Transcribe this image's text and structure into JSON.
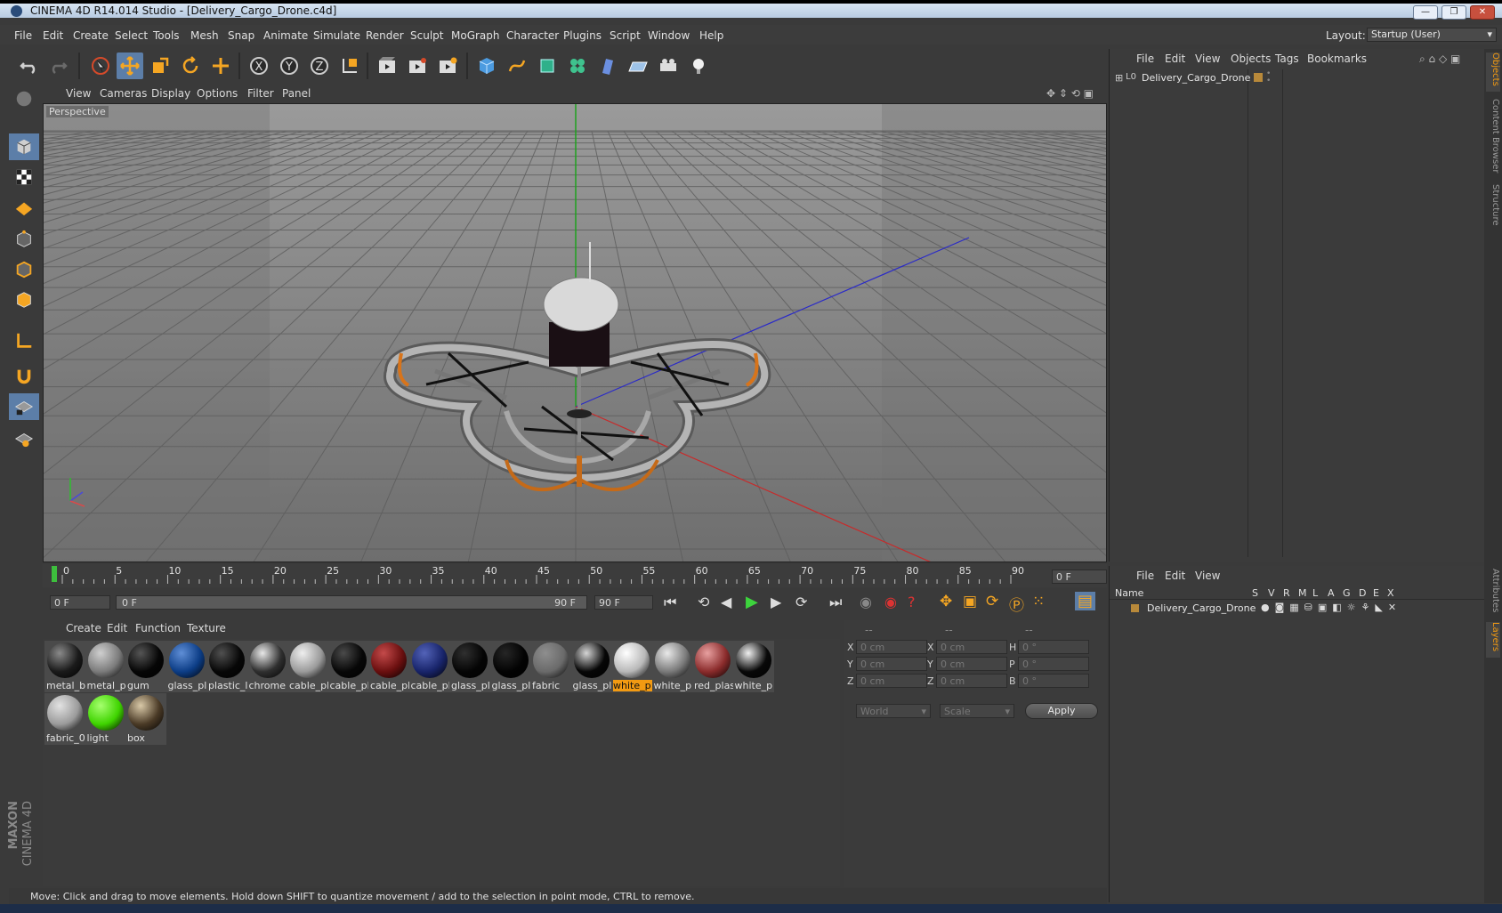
{
  "window": {
    "title": "CINEMA 4D R14.014 Studio - [Delivery_Cargo_Drone.c4d]",
    "controls": [
      "—",
      "❐",
      "✕"
    ]
  },
  "menubar": {
    "items": [
      "File",
      "Edit",
      "Create",
      "Select",
      "Tools",
      "Mesh",
      "Snap",
      "Animate",
      "Simulate",
      "Render",
      "Sculpt",
      "MoGraph",
      "Character",
      "Plugins",
      "Script",
      "Window",
      "Help"
    ],
    "layout_label": "Layout:",
    "layout_value": "Startup (User)"
  },
  "viewport": {
    "menus": [
      "View",
      "Cameras",
      "Display",
      "Options",
      "Filter",
      "Panel"
    ],
    "label": "Perspective"
  },
  "timeline": {
    "ticks": [
      "0",
      "5",
      "10",
      "15",
      "20",
      "25",
      "30",
      "35",
      "40",
      "45",
      "50",
      "55",
      "60",
      "65",
      "70",
      "75",
      "80",
      "85",
      "90"
    ],
    "current_frame": "0 F",
    "start_field": "0 F",
    "range_start": "0 F",
    "range_end": "90 F",
    "end_field": "90 F"
  },
  "materials": {
    "menus": [
      "Create",
      "Edit",
      "Function",
      "Texture"
    ],
    "items": [
      {
        "label": "metal_b",
        "color": "#1a1a1a",
        "hi": "#8a8a8a"
      },
      {
        "label": "metal_p",
        "color": "#7b7b7b",
        "hi": "#cfcfcf"
      },
      {
        "label": "gum",
        "color": "#060606",
        "hi": "#555"
      },
      {
        "label": "glass_pl",
        "color": "#0c3d86",
        "hi": "#5f8ed6"
      },
      {
        "label": "plastic_l",
        "color": "#070707",
        "hi": "#505050"
      },
      {
        "label": "chrome",
        "color": "#2f2f2f",
        "hi": "#e8e8e8"
      },
      {
        "label": "cable_pl",
        "color": "#9a9a9a",
        "hi": "#eeeeee"
      },
      {
        "label": "cable_pl",
        "color": "#070707",
        "hi": "#4a4a4a"
      },
      {
        "label": "cable_pl",
        "color": "#6a0f0f",
        "hi": "#c44a4a"
      },
      {
        "label": "cable_pl",
        "color": "#18246a",
        "hi": "#5363b8"
      },
      {
        "label": "glass_pl",
        "color": "#050505",
        "hi": "#303030"
      },
      {
        "label": "glass_pl",
        "color": "#030303",
        "hi": "#262626"
      },
      {
        "label": "fabric",
        "color": "#6a6a6a",
        "hi": "#8e8e8e"
      },
      {
        "label": "glass_pl",
        "color": "#060606",
        "hi": "#d5d5d5"
      },
      {
        "label": "white_p",
        "color": "#b8b8b8",
        "hi": "#ffffff",
        "selected": true
      },
      {
        "label": "white_p",
        "color": "#7a7a7a",
        "hi": "#e9e9e9"
      },
      {
        "label": "red_plas",
        "color": "#8a2b2b",
        "hi": "#e8a0a0"
      },
      {
        "label": "white_p",
        "color": "#080808",
        "hi": "#f0f0f0"
      },
      {
        "label": "fabric_0",
        "color": "#9b9b9b",
        "hi": "#e2e2e2"
      },
      {
        "label": "light",
        "color": "#3fd400",
        "hi": "#a6ff6f"
      },
      {
        "label": "box",
        "color": "#4a3a26",
        "hi": "#d9c9a8"
      }
    ]
  },
  "coordinates": {
    "headers": [
      "--",
      "--",
      "--"
    ],
    "rows": [
      {
        "a": "X",
        "av": "0 cm",
        "b": "X",
        "bv": "0 cm",
        "c": "H",
        "cv": "0 °"
      },
      {
        "a": "Y",
        "av": "0 cm",
        "b": "Y",
        "bv": "0 cm",
        "c": "P",
        "cv": "0 °"
      },
      {
        "a": "Z",
        "av": "0 cm",
        "b": "Z",
        "bv": "0 cm",
        "c": "B",
        "cv": "0 °"
      }
    ],
    "mode": "World",
    "type": "Scale",
    "apply": "Apply"
  },
  "object_manager": {
    "menus": [
      "File",
      "Edit",
      "View",
      "Objects",
      "Tags",
      "Bookmarks"
    ],
    "object": "Delivery_Cargo_Drone",
    "object_prefix": "L0"
  },
  "layer_manager": {
    "menus": [
      "File",
      "Edit",
      "View"
    ],
    "columns": [
      "Name",
      "S",
      "V",
      "R",
      "M",
      "L",
      "A",
      "G",
      "D",
      "E",
      "X"
    ],
    "layer": "Delivery_Cargo_Drone"
  },
  "side_tabs": [
    "Objects",
    "Content Browser",
    "Structure",
    "Attributes",
    "Layers"
  ],
  "status": "Move: Click and drag to move elements. Hold down SHIFT to quantize movement / add to the selection in point mode, CTRL to remove.",
  "branding": {
    "maxon": "MAXON",
    "product": "CINEMA 4D"
  }
}
